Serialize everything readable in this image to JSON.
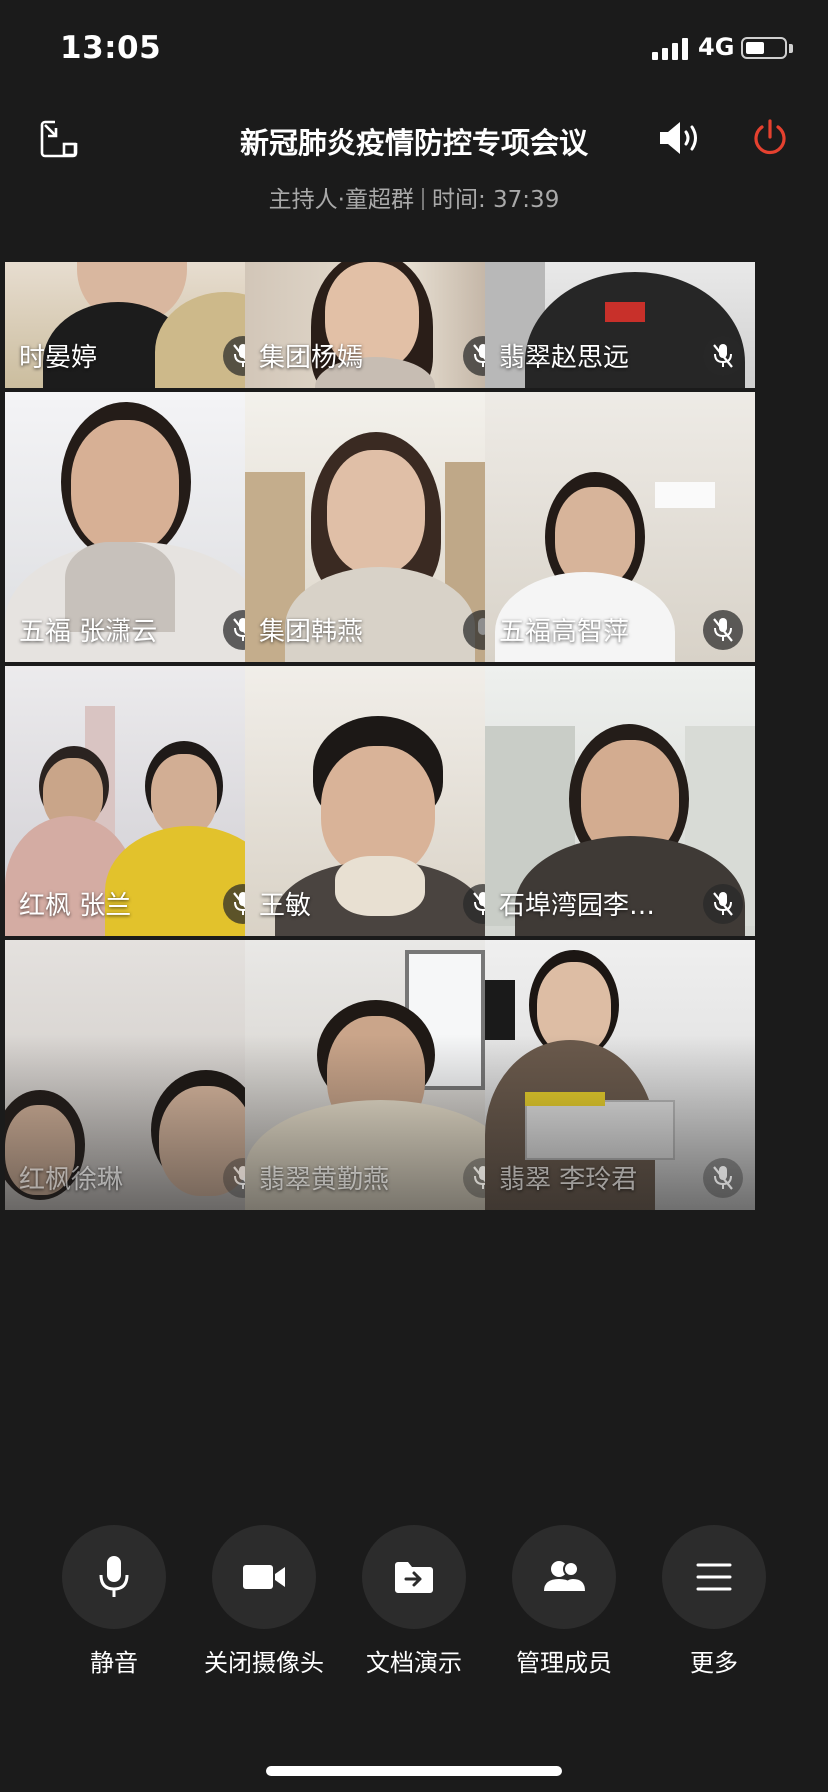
{
  "status": {
    "time": "13:05",
    "network": "4G",
    "battery_level": 0.5
  },
  "header": {
    "title": "新冠肺炎疫情防控专项会议",
    "host_label": "主持人·童超群",
    "time_label": "时间: 37:39"
  },
  "participants": [
    {
      "name": "时晏婷",
      "mic": "muted"
    },
    {
      "name": "集团杨嫣",
      "mic": "muted"
    },
    {
      "name": "翡翠赵思远",
      "mic": "muted"
    },
    {
      "name": "五福 张潇云",
      "mic": "muted"
    },
    {
      "name": "集团韩燕",
      "mic": "speaking"
    },
    {
      "name": "五福高智萍",
      "mic": "muted"
    },
    {
      "name": "红枫 张兰",
      "mic": "muted"
    },
    {
      "name": "王敏",
      "mic": "muted"
    },
    {
      "name": "石埠湾园李…",
      "mic": "muted"
    },
    {
      "name": "红枫徐琳",
      "mic": "muted"
    },
    {
      "name": "翡翠黄勤燕",
      "mic": "muted"
    },
    {
      "name": "翡翠 李玲君",
      "mic": "muted"
    }
  ],
  "controls": {
    "mute": "静音",
    "camera_off": "关闭摄像头",
    "doc_present": "文档演示",
    "manage_members": "管理成员",
    "more": "更多"
  },
  "colors": {
    "background": "#1b1b1b",
    "power_red": "#e5412f",
    "control_circle": "#2c2c2c"
  },
  "icons": [
    "minimize-window-icon",
    "speaker-icon",
    "power-icon",
    "microphone-icon",
    "video-camera-icon",
    "folder-share-icon",
    "members-icon",
    "menu-icon"
  ]
}
